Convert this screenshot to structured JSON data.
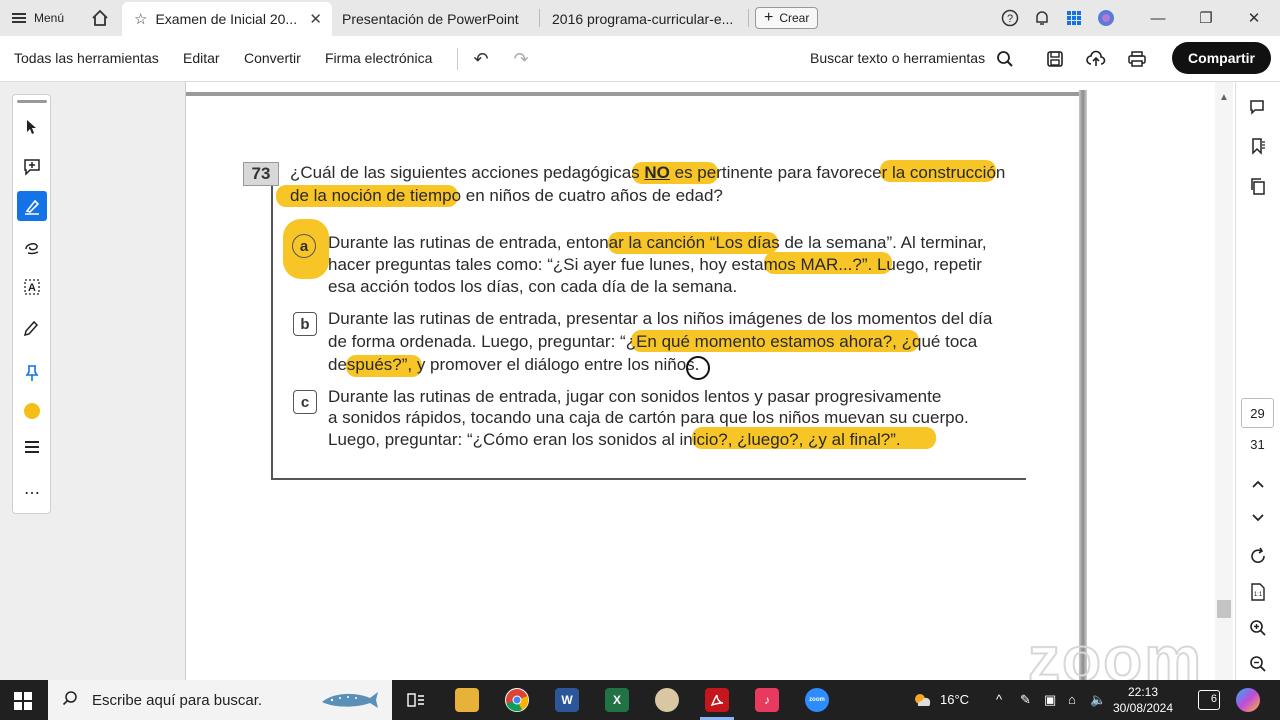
{
  "tabbar": {
    "menu_label": "Menú",
    "tabs": [
      {
        "label": "Examen de Inicial 20...",
        "active": true
      },
      {
        "label": "Presentación de PowerPoint"
      },
      {
        "label": "2016 programa-curricular-e..."
      }
    ],
    "create_label": "Crear"
  },
  "toolbar": {
    "all_tools": "Todas las herramientas",
    "edit": "Editar",
    "convert": "Convertir",
    "sign": "Firma electrónica",
    "search_label": "Buscar texto o herramientas",
    "share_label": "Compartir"
  },
  "document": {
    "question_number": "73",
    "stem_line1_a": "¿Cuál de las siguientes acciones pedagógicas ",
    "stem_emph": "NO",
    "stem_line1_b": " es pertinente para favorecer la construcción",
    "stem_line2": "de la noción de tiempo en niños de cuatro años de edad?",
    "options": [
      {
        "letter": "a",
        "lines": [
          "Durante las rutinas de entrada, entonar la canción “Los días de la semana”. Al terminar,",
          "hacer preguntas tales como: “¿Si ayer fue lunes, hoy estamos MAR...?”. Luego, repetir",
          "esa acción todos los días, con cada día de la semana."
        ]
      },
      {
        "letter": "b",
        "lines": [
          "Durante las rutinas de entrada, presentar a los niños imágenes de los momentos del día",
          "de forma ordenada. Luego, preguntar: “¿En qué momento estamos ahora?, ¿qué toca",
          "después?”, y promover el diálogo entre los niños."
        ]
      },
      {
        "letter": "c",
        "lines": [
          "Durante las rutinas de entrada, jugar con sonidos lentos y pasar progresivamente",
          "a sonidos rápidos, tocando una caja de cartón para que los niños muevan su cuerpo.",
          "Luego, preguntar: “¿Cómo eran los sonidos al inicio?, ¿luego?, ¿y al final?”."
        ]
      }
    ],
    "highlight_color": "#f7c21a",
    "watermark": "zoom"
  },
  "right_panel": {
    "page_current": "29",
    "page_total": "31"
  },
  "taskbar": {
    "search_placeholder": "Escribe aquí para buscar.",
    "weather": "16°C",
    "time": "22:13",
    "date": "30/08/2024",
    "notifications": "6"
  }
}
